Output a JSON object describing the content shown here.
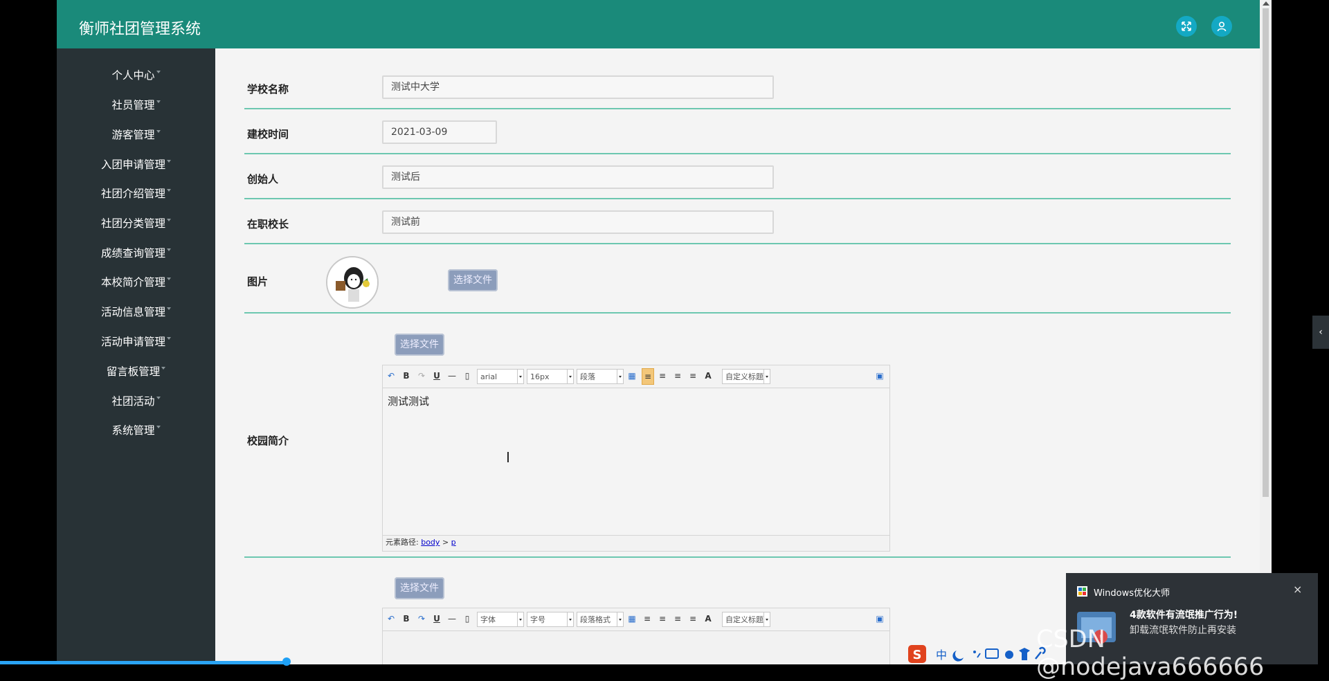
{
  "app": {
    "title": "衡师社团管理系统"
  },
  "sidebar": {
    "items": [
      {
        "label": "个人中心"
      },
      {
        "label": "社员管理"
      },
      {
        "label": "游客管理"
      },
      {
        "label": "入团申请管理"
      },
      {
        "label": "社团介绍管理"
      },
      {
        "label": "社团分类管理"
      },
      {
        "label": "成绩查询管理"
      },
      {
        "label": "本校简介管理"
      },
      {
        "label": "活动信息管理"
      },
      {
        "label": "活动申请管理"
      },
      {
        "label": "留言板管理"
      },
      {
        "label": "社团活动"
      },
      {
        "label": "系统管理"
      }
    ]
  },
  "form": {
    "school_name": {
      "label": "学校名称",
      "value": "测试中大学"
    },
    "founded": {
      "label": "建校时间",
      "value": "2021-03-09"
    },
    "founder": {
      "label": "创始人",
      "value": "测试后"
    },
    "principal": {
      "label": "在职校长",
      "value": "测试前"
    },
    "image": {
      "label": "图片",
      "button": "选择文件"
    },
    "campus_intro": {
      "label": "校园简介",
      "button": "选择文件",
      "content": "测试测试",
      "path_prefix": "元素路径:",
      "path_body": "body",
      "path_sep": ">",
      "path_p": "p"
    },
    "editor1_toolbar": {
      "font": "arial",
      "size": "16px",
      "para": "段落",
      "custom": "自定义标题"
    },
    "editor2_toolbar": {
      "font": "字体",
      "size": "字号",
      "para": "段落格式",
      "custom": "自定义标题"
    },
    "second_button": "选择文件"
  },
  "notification": {
    "app": "Windows优化大师",
    "headline": "4款软件有流氓推广行为!",
    "body": "卸载流氓软件防止再安装",
    "close": "×"
  },
  "watermark": "CSDN @nodejava666666",
  "colors": {
    "topbar": "#1a8a7a",
    "sidebar": "#283236",
    "divider": "#6cc7b0",
    "button": "#8c9dbb"
  },
  "icons": {
    "fullscreen": "fullscreen-icon",
    "user": "user-icon"
  }
}
